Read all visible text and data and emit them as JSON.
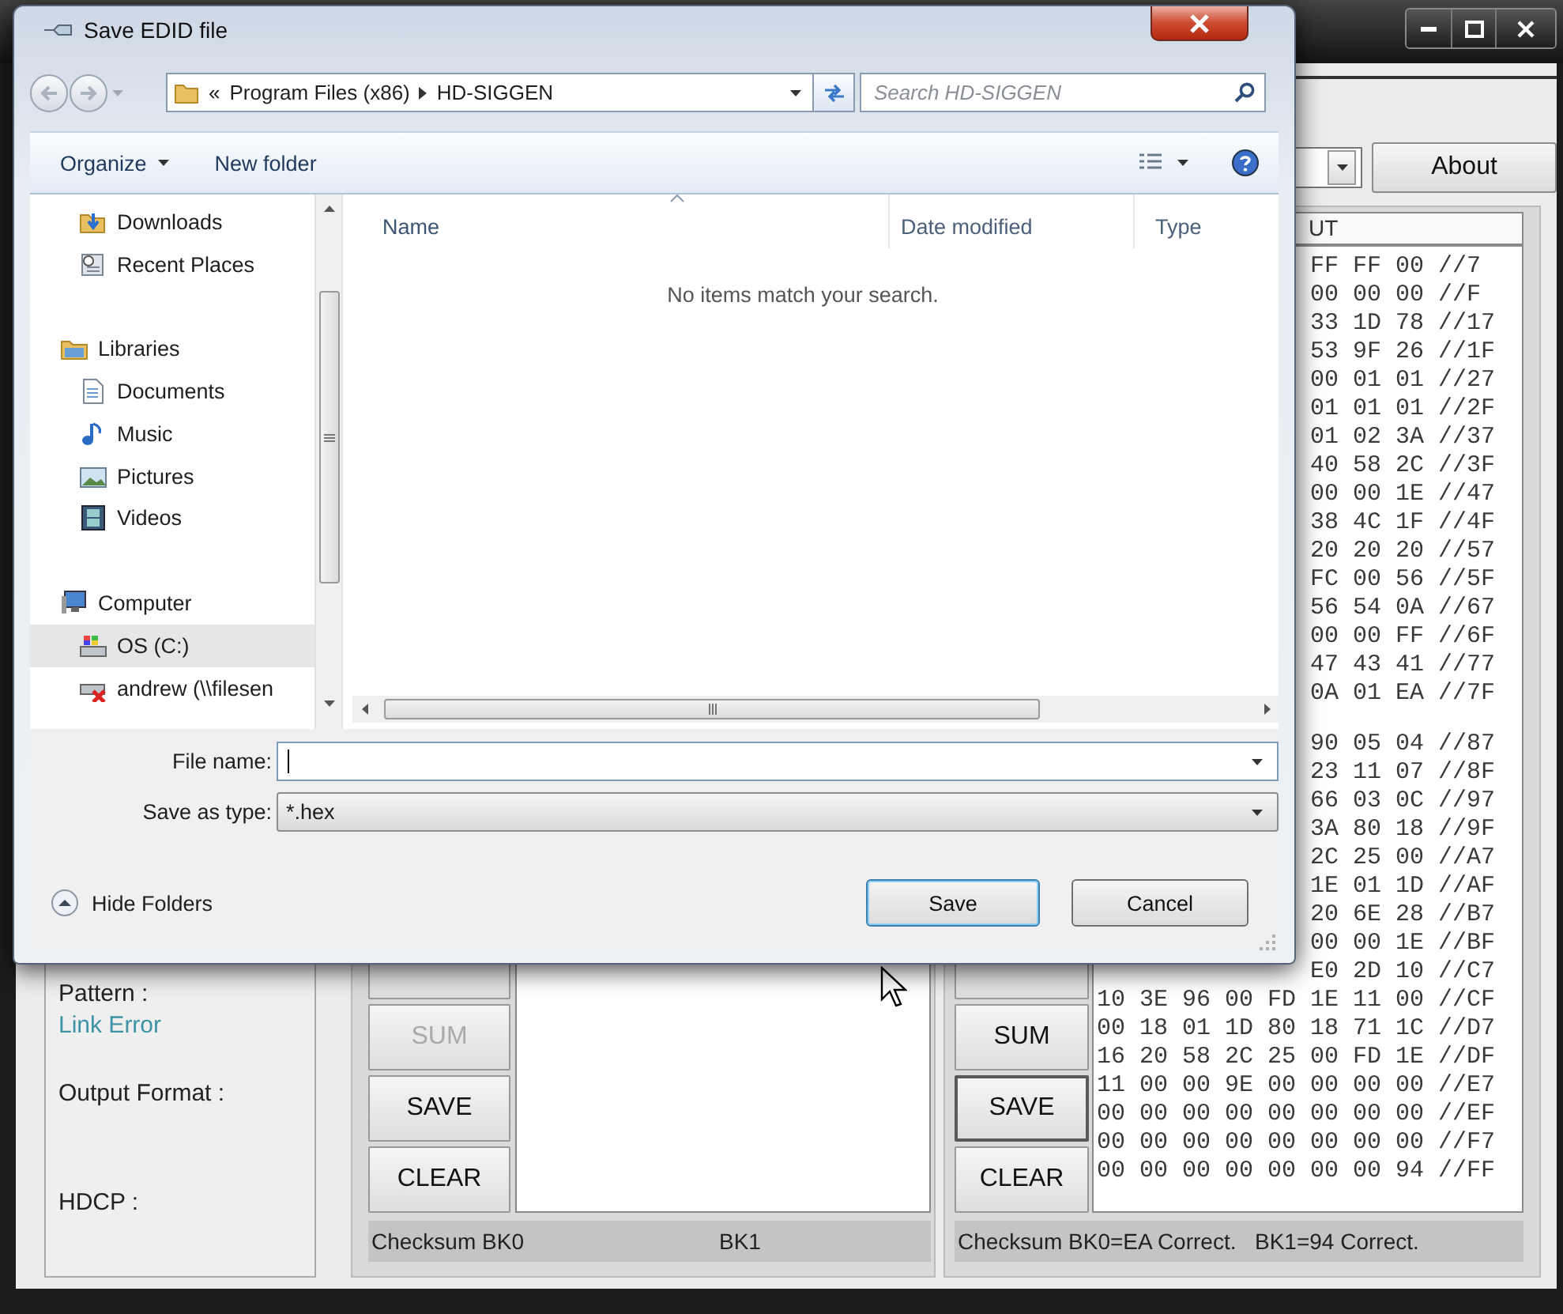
{
  "app": {
    "about_button": "About",
    "status_fields": [
      {
        "label": "Pattern :",
        "value": "Link Error"
      },
      {
        "label": "Output Format :"
      },
      {
        "label": "HDCP :"
      }
    ],
    "blocks": [
      {
        "buttons": [
          {
            "label": "SUM",
            "disabled": true,
            "focused": false
          },
          {
            "label": "SAVE",
            "disabled": false,
            "focused": false
          },
          {
            "label": "CLEAR",
            "disabled": false,
            "focused": false
          }
        ],
        "status": [
          "Checksum BK0",
          "BK1"
        ]
      },
      {
        "buttons": [
          {
            "label": "SUM",
            "disabled": false,
            "focused": false
          },
          {
            "label": "SAVE",
            "disabled": false,
            "focused": true
          },
          {
            "label": "CLEAR",
            "disabled": false,
            "focused": false
          }
        ],
        "output": {
          "header": "UT",
          "sections": [
            [
              "FF FF 00 //7",
              "00 00 00 //F",
              "33 1D 78 //17",
              "53 9F 26 //1F",
              "00 01 01 //27",
              "01 01 01 //2F",
              "01 02 3A //37",
              "40 58 2C //3F",
              "00 00 1E //47",
              "38 4C 1F //4F",
              "20 20 20 //57",
              "FC 00 56 //5F",
              "56 54 0A //67",
              "00 00 FF //6F",
              "47 43 41 //77",
              "0A 01 EA //7F"
            ],
            [
              "90 05 04 //87",
              "23 11 07 //8F",
              "66 03 0C //97",
              "3A 80 18 //9F",
              "2C 25 00 //A7",
              "1E 01 1D //AF",
              "20 6E 28 //B7",
              "00 00 1E //BF",
              "E0 2D 10 //C7",
              "10 3E 96 00 FD 1E 11 00 //CF",
              "00 18 01 1D 80 18 71 1C //D7",
              "16 20 58 2C 25 00 FD 1E //DF",
              "11 00 00 9E 00 00 00 00 //E7",
              "00 00 00 00 00 00 00 00 //EF",
              "00 00 00 00 00 00 00 00 //F7",
              "00 00 00 00 00 00 00 94 //FF"
            ]
          ]
        },
        "status": [
          "Checksum BK0=EA Correct.",
          "BK1=94 Correct."
        ]
      }
    ]
  },
  "dialog": {
    "title": "Save EDID file",
    "address": {
      "overflow": "«",
      "path": [
        "Program Files (x86)",
        "HD-SIGGEN"
      ]
    },
    "search": {
      "placeholder": "Search HD-SIGGEN"
    },
    "toolbar": {
      "organize": "Organize",
      "new_folder": "New folder"
    },
    "nav": [
      {
        "label": "Downloads",
        "kind": "downloads",
        "selected": false
      },
      {
        "label": "Recent Places",
        "kind": "recent",
        "selected": false
      },
      {
        "label": "Libraries",
        "kind": "libraries",
        "selected": false,
        "children": [
          {
            "label": "Documents",
            "kind": "documents",
            "selected": false
          },
          {
            "label": "Music",
            "kind": "music",
            "selected": false
          },
          {
            "label": "Pictures",
            "kind": "pictures",
            "selected": false
          },
          {
            "label": "Videos",
            "kind": "videos",
            "selected": false
          }
        ]
      },
      {
        "label": "Computer",
        "kind": "computer",
        "selected": false,
        "children": [
          {
            "label": "OS (C:)",
            "kind": "drive",
            "selected": true
          },
          {
            "label": "andrew (\\\\filesen",
            "kind": "network-drive",
            "selected": false
          }
        ]
      }
    ],
    "columns": [
      {
        "label": "Name",
        "sorted": true
      },
      {
        "label": "Date modified",
        "sorted": false
      },
      {
        "label": "Type",
        "sorted": false
      }
    ],
    "empty_message": "No items match your search.",
    "file_name": {
      "label": "File name:"
    },
    "save_type": {
      "label": "Save as type:",
      "value": "*.hex"
    },
    "hide_folders": "Hide Folders",
    "buttons": [
      {
        "label": "Save",
        "default": true
      },
      {
        "label": "Cancel",
        "default": false
      }
    ]
  }
}
